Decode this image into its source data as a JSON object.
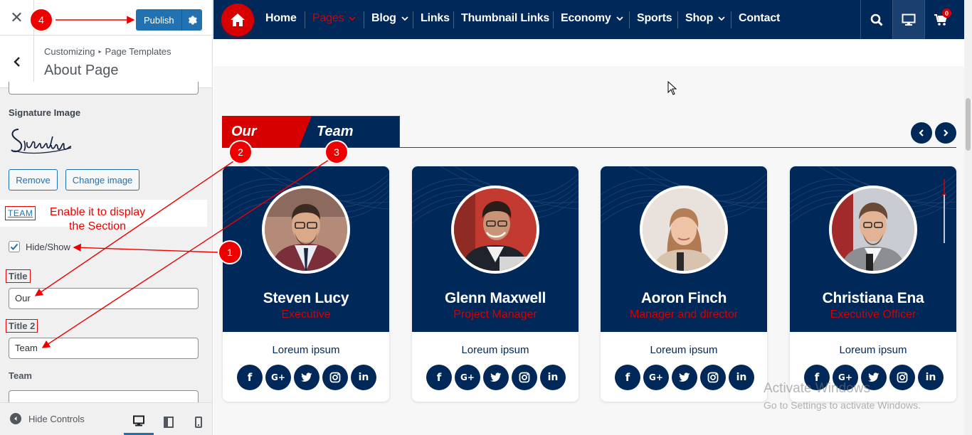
{
  "sidebar": {
    "close_icon": "close-icon",
    "publish_label": "Publish",
    "breadcrumb": [
      "Customizing",
      "Page Templates"
    ],
    "section_title": "About Page",
    "signature_image_label": "Signature Image",
    "signature_text": "Signature",
    "remove_label": "Remove",
    "change_image_label": "Change image",
    "team_heading": "TEAM",
    "hide_show_label": "Hide/Show",
    "hide_show_checked": true,
    "title_label": "Title",
    "title_value": "Our",
    "title2_label": "Title 2",
    "title2_value": "Team",
    "team_label": "Team",
    "hide_controls_label": "Hide Controls"
  },
  "annotations": {
    "note": "Enable it to display the Section",
    "badges": [
      "1",
      "2",
      "3",
      "4"
    ],
    "color": "#e00000"
  },
  "navbar": {
    "items": [
      {
        "label": "Home",
        "dropdown": false
      },
      {
        "label": "Pages",
        "dropdown": true,
        "active": true
      },
      {
        "label": "Blog",
        "dropdown": true
      },
      {
        "label": "Links",
        "dropdown": false
      },
      {
        "label": "Thumbnail Links",
        "dropdown": false
      },
      {
        "label": "Economy",
        "dropdown": true
      },
      {
        "label": "Sports",
        "dropdown": false
      },
      {
        "label": "Shop",
        "dropdown": true
      },
      {
        "label": "Contact",
        "dropdown": false
      }
    ],
    "cart_count": "0",
    "bg_color": "#002858",
    "accent_color": "#d70000"
  },
  "team_section": {
    "title": "Our",
    "title2": "Team",
    "members": [
      {
        "name": "Steven Lucy",
        "role": "Executive",
        "desc": "Loreum ipsum"
      },
      {
        "name": "Glenn Maxwell",
        "role": "Project Manager",
        "desc": "Loreum ipsum"
      },
      {
        "name": "Aoron Finch",
        "role": "Manager and director",
        "desc": "Loreum ipsum"
      },
      {
        "name": "Christiana Ena",
        "role": "Executive Officer",
        "desc": "Loreum ipsum"
      }
    ],
    "social_icons": [
      "facebook-icon",
      "google-plus-icon",
      "twitter-icon",
      "instagram-icon",
      "linkedin-icon"
    ]
  },
  "watermark": {
    "line1": "Activate Windows",
    "line2": "Go to Settings to activate Windows."
  }
}
